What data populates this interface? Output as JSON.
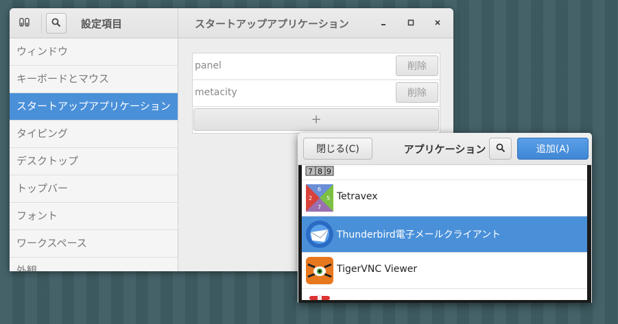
{
  "main_window": {
    "sidebar_title": "設定項目",
    "page_title": "スタートアップアプリケーション",
    "sidebar_items": [
      {
        "label": "ウィンドウ"
      },
      {
        "label": "キーボードとマウス"
      },
      {
        "label": "スタートアップアプリケーション",
        "selected": true
      },
      {
        "label": "タイピング"
      },
      {
        "label": "デスクトップ"
      },
      {
        "label": "トップバー"
      },
      {
        "label": "フォント"
      },
      {
        "label": "ワークスペース"
      },
      {
        "label": "外観"
      }
    ],
    "startup_apps": [
      {
        "name": "panel",
        "remove_label": "削除"
      },
      {
        "name": "metacity",
        "remove_label": "削除"
      }
    ],
    "add_label": "+"
  },
  "dialog": {
    "close_label": "閉じる(C)",
    "title": "アプリケーション",
    "add_label": "追加(A)",
    "apps": [
      {
        "name": "",
        "icon": "sudoku-icon"
      },
      {
        "name": "Tetravex",
        "icon": "tetravex-icon"
      },
      {
        "name": "Thunderbird電子メールクライアント",
        "icon": "thunderbird-icon",
        "selected": true
      },
      {
        "name": "TigerVNC Viewer",
        "icon": "tigervnc-icon"
      },
      {
        "name": "",
        "icon": "red-app-icon"
      }
    ]
  },
  "colors": {
    "accent": "#4a90d9",
    "desktop": "#3e5d63"
  }
}
